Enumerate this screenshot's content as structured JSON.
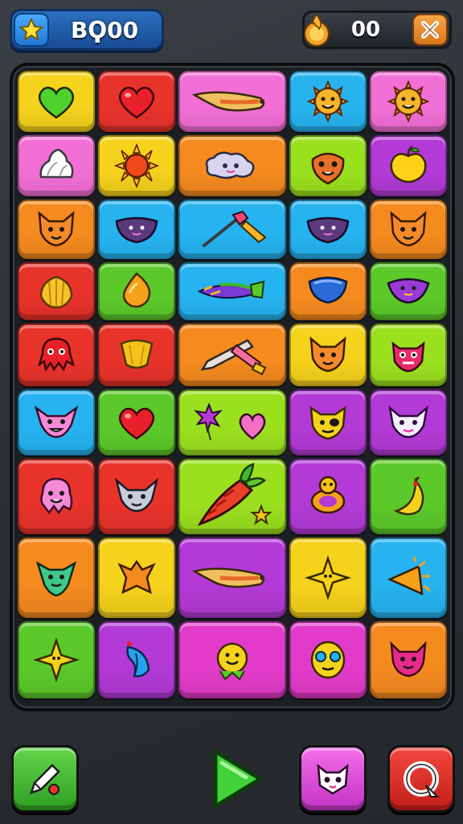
{
  "header": {
    "score": "BϘ00",
    "coins": "00",
    "star_icon": "star-icon",
    "coin_icon": "coin-flame-icon",
    "close_icon": "close-x-icon"
  },
  "colors": {
    "yellow": "#f5d21c",
    "red": "#e8332b",
    "pink": "#f26fd6",
    "blue": "#26b3f0",
    "orange": "#f58a1f",
    "green": "#5cc92a",
    "lime": "#9be01f",
    "purple": "#b33ad6",
    "magenta": "#e33bc9"
  },
  "board": {
    "tiles": [
      {
        "color": "yellow",
        "icon": "green-heart-icon"
      },
      {
        "color": "red",
        "icon": "red-heart-icon"
      },
      {
        "color": "pink",
        "icon": "horn-icon",
        "wide": true
      },
      {
        "color": "blue",
        "icon": "sun-face-icon"
      },
      {
        "color": "pink",
        "icon": "sun-face-icon"
      },
      {
        "color": "pink",
        "icon": "cream-swirl-icon"
      },
      {
        "color": "yellow",
        "icon": "sun-icon"
      },
      {
        "color": "orange",
        "icon": "cloud-creature-icon",
        "wide": true
      },
      {
        "color": "lime",
        "icon": "mask-face-icon"
      },
      {
        "color": "purple",
        "icon": "apple-icon"
      },
      {
        "color": "orange",
        "icon": "cat-face-icon"
      },
      {
        "color": "blue",
        "icon": "bowl-creature-icon"
      },
      {
        "color": "blue",
        "icon": "paintbrush-icon",
        "wide": true
      },
      {
        "color": "blue",
        "icon": "bowl-creature-icon"
      },
      {
        "color": "orange",
        "icon": "cat-face-icon"
      },
      {
        "color": "red",
        "icon": "shell-icon"
      },
      {
        "color": "green",
        "icon": "leaf-drop-icon"
      },
      {
        "color": "blue",
        "icon": "carrot-icon",
        "wide": true
      },
      {
        "color": "orange",
        "icon": "blue-bowl-icon"
      },
      {
        "color": "green",
        "icon": "purple-bowl-icon"
      },
      {
        "color": "red",
        "icon": "octopus-icon"
      },
      {
        "color": "red",
        "icon": "bell-icon"
      },
      {
        "color": "orange",
        "icon": "pencil-icon",
        "wide": true
      },
      {
        "color": "yellow",
        "icon": "cat-face-icon"
      },
      {
        "color": "lime",
        "icon": "monster-face-icon"
      },
      {
        "color": "blue",
        "icon": "pink-cat-icon"
      },
      {
        "color": "green",
        "icon": "red-heart-icon"
      },
      {
        "color": "lime",
        "icon": "flower-heart-icon",
        "wide": true
      },
      {
        "color": "purple",
        "icon": "pirate-cat-icon"
      },
      {
        "color": "purple",
        "icon": "white-cat-icon"
      },
      {
        "color": "red",
        "icon": "pink-octopus-icon"
      },
      {
        "color": "red",
        "icon": "gray-cat-icon"
      },
      {
        "color": "lime",
        "icon": "big-carrot-icon",
        "big": true
      },
      {
        "color": "purple",
        "icon": "ring-creature-icon"
      },
      {
        "color": "green",
        "icon": "banana-icon"
      },
      {
        "color": "orange",
        "icon": "green-cat-icon"
      },
      {
        "color": "yellow",
        "icon": "orange-star-icon"
      },
      {
        "color": "purple",
        "icon": "horn-icon",
        "wide": true
      },
      {
        "color": "yellow",
        "icon": "yellow-star-icon"
      },
      {
        "color": "blue",
        "icon": "sun-wedge-icon"
      },
      {
        "color": "green",
        "icon": "yellow-star-icon"
      },
      {
        "color": "purple",
        "icon": "feather-icon"
      },
      {
        "color": "magenta",
        "icon": "smiley-icon",
        "wide": true
      },
      {
        "color": "magenta",
        "icon": "alien-face-icon"
      },
      {
        "color": "orange",
        "icon": "pink-monster-icon"
      }
    ]
  },
  "footer": {
    "hint_icon": "pencil-edit-icon",
    "play_icon": "play-icon",
    "cat_icon": "cat-mask-icon",
    "restart_icon": "restart-icon"
  }
}
